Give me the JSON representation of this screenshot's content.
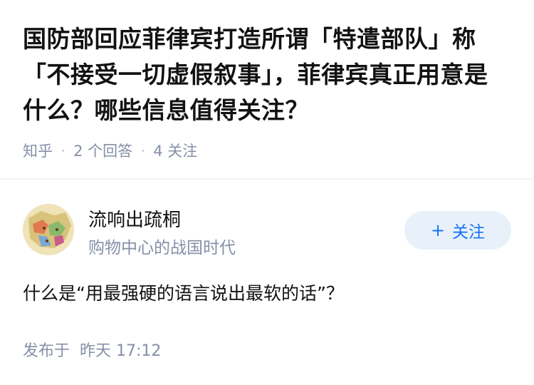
{
  "question": {
    "title": "国防部回应菲律宾打造所谓「特遣部队」称「不接受一切虚假叙事」，菲律宾真正用意是什么？哪些信息值得关注？",
    "source": "知乎",
    "answers": "2 个回答",
    "followers": "4 关注"
  },
  "author": {
    "name": "流响出疏桐",
    "bio": "购物中心的战国时代",
    "follow_icon": "plus-icon",
    "follow_label": "关注"
  },
  "answer": {
    "text": "什么是“用最强硬的语言说出最软的话”？",
    "published_label": "发布于",
    "published_time": "昨天 17:12"
  },
  "colors": {
    "accent": "#1772f6",
    "follow_bg": "#e8f1fa",
    "meta": "#8590a6",
    "text": "#121212"
  }
}
